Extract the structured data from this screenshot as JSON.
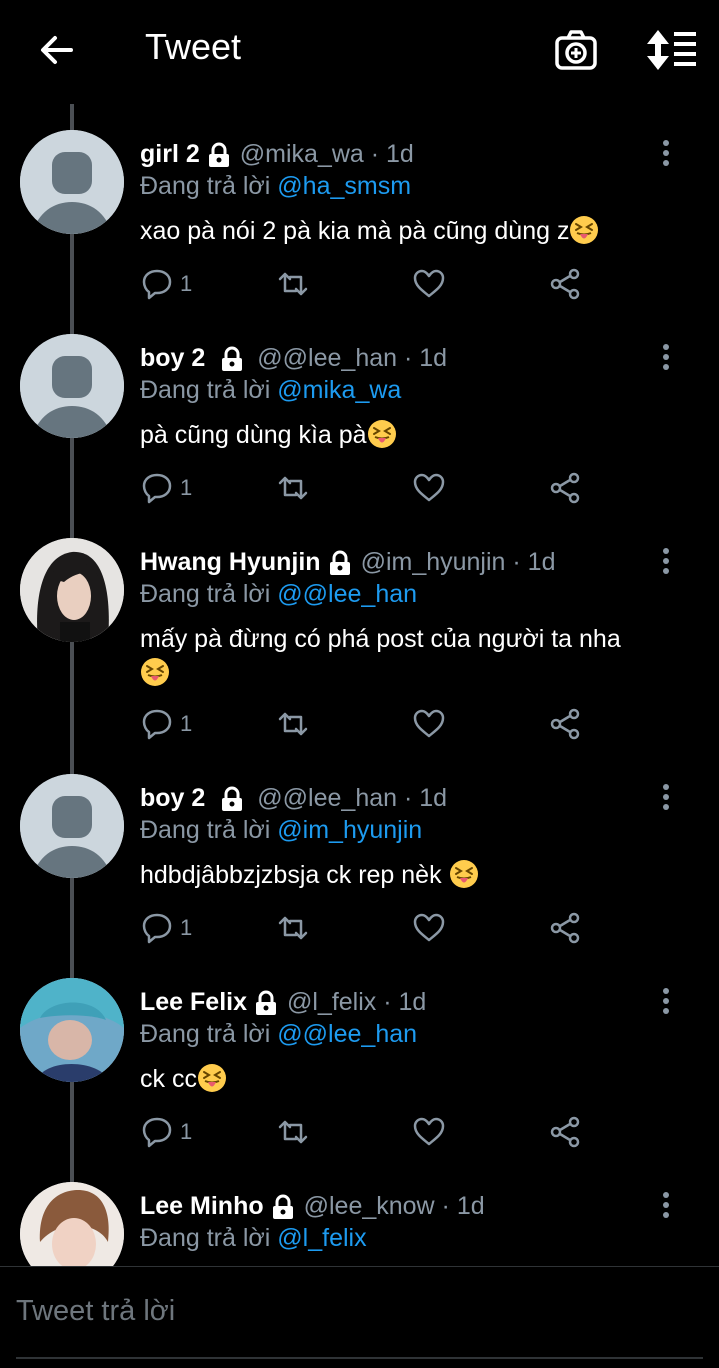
{
  "header": {
    "title": "Tweet"
  },
  "colors": {
    "accent": "#1d9bf0",
    "muted": "#8b98a5",
    "background": "#000000"
  },
  "icons": {
    "back": "arrow-left-icon",
    "camera": "camera-plus-icon",
    "sort": "sort-icon",
    "lock": "lock-icon",
    "more": "more-vertical-icon",
    "reply": "reply-icon",
    "retweet": "retweet-icon",
    "like": "heart-icon",
    "share": "share-icon",
    "emoji": "squinting-tongue-emoji"
  },
  "tweets": [
    {
      "name": "girl 2",
      "handle": "@mika_wa · 1d",
      "reply_prefix": "Đang trả lời",
      "reply_to": "@ha_smsm",
      "text": "xao pà nói 2 pà kia mà pà cũng dùng z",
      "reply_count": "1"
    },
    {
      "name": "boy 2",
      "handle": "@@lee_han · 1d",
      "reply_prefix": "Đang trả lời",
      "reply_to": "@mika_wa",
      "text": "pà cũng dùng kìa pà",
      "reply_count": "1"
    },
    {
      "name": "Hwang Hyunjin",
      "handle": "@im_hyunjin · 1d",
      "reply_prefix": "Đang trả lời",
      "reply_to": "@@lee_han",
      "text": "mấy pà đừng có phá post của người ta nha",
      "reply_count": "1"
    },
    {
      "name": "boy 2",
      "handle": "@@lee_han · 1d",
      "reply_prefix": "Đang trả lời",
      "reply_to": "@im_hyunjin",
      "text": "hdbdjâbbzjzbsja ck rep nèk ",
      "reply_count": "1"
    },
    {
      "name": "Lee Felix",
      "handle": "@l_felix · 1d",
      "reply_prefix": "Đang trả lời",
      "reply_to": "@@lee_han",
      "text": "ck cc",
      "reply_count": "1"
    },
    {
      "name": "Lee Minho",
      "handle": "@lee_know · 1d",
      "reply_prefix": "Đang trả lời",
      "reply_to": "@l_felix"
    }
  ],
  "reply_bar": {
    "placeholder": "Tweet trả lời"
  }
}
